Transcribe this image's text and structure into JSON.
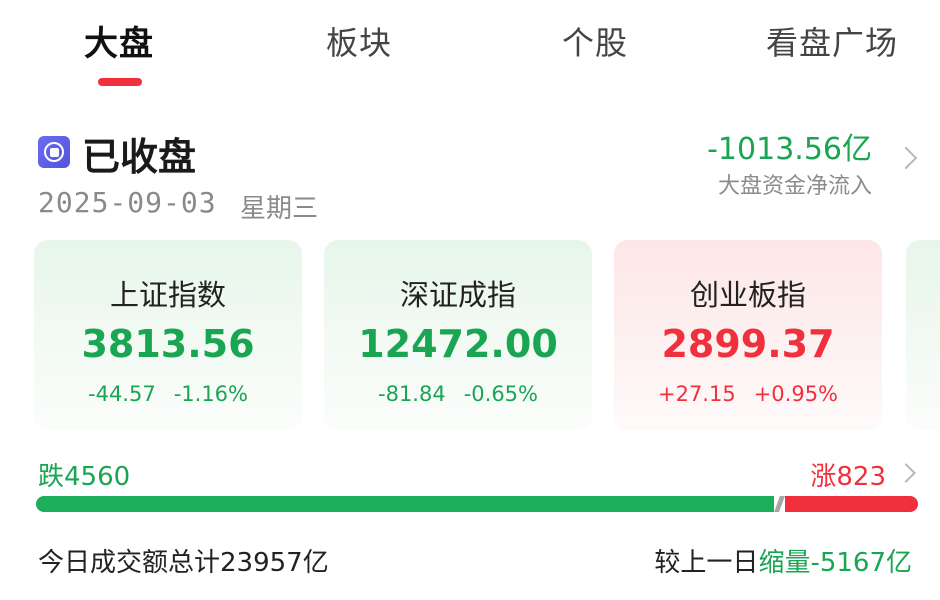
{
  "tabs": [
    {
      "label": "大盘",
      "active": true
    },
    {
      "label": "板块",
      "active": false
    },
    {
      "label": "个股",
      "active": false
    },
    {
      "label": "看盘广场",
      "active": false
    }
  ],
  "status": {
    "title": "已收盘",
    "date": "2025-09-03",
    "weekday": "星期三",
    "icon": "stop-icon"
  },
  "fund_flow": {
    "value": "-1013.56亿",
    "label": "大盘资金净流入"
  },
  "indices": [
    {
      "name": "上证指数",
      "value": "3813.56",
      "change": "-44.57",
      "pct": "-1.16%",
      "direction": "down"
    },
    {
      "name": "深证成指",
      "value": "12472.00",
      "change": "-81.84",
      "pct": "-0.65%",
      "direction": "down"
    },
    {
      "name": "创业板指",
      "value": "2899.37",
      "change": "+27.15",
      "pct": "+0.95%",
      "direction": "up"
    }
  ],
  "breadth": {
    "fall_label": "跌",
    "fall_count": 4560,
    "rise_label": "涨",
    "rise_count": 823,
    "fall_text": "跌4560",
    "rise_text": "涨823"
  },
  "volume": {
    "total_text": "今日成交额总计23957亿",
    "compare_prefix": "较上一日",
    "compare_value": "缩量-5167亿"
  },
  "colors": {
    "up": "#f0303d",
    "down": "#1aa552",
    "accent": "#f0303d",
    "status_icon": "#5d5ee3"
  }
}
